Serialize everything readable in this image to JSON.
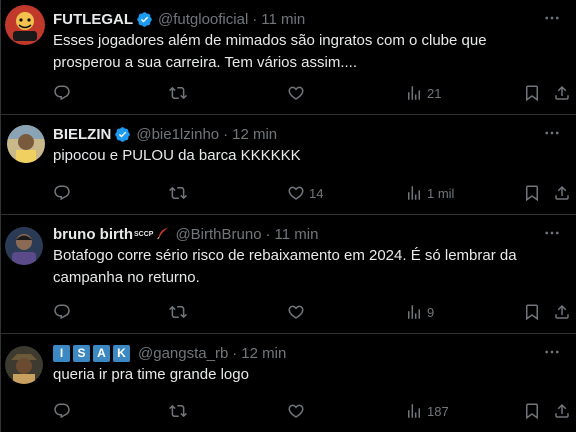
{
  "colors": {
    "background": "#000000",
    "text_primary": "#e7e9ea",
    "text_secondary": "#71767b",
    "verified_blue": "#1d9bf0",
    "divider": "#2f3336"
  },
  "tweets": [
    {
      "display_name": "FUTLEGAL",
      "verified": true,
      "handle": "@futglooficial",
      "separator": "·",
      "time": "11 min",
      "text": "Esses jogadores além de mimados são ingratos com o clube que prosperou a sua carreira. Tem vários assim....",
      "replies": "",
      "retweets": "",
      "likes": "",
      "views": "21"
    },
    {
      "display_name": "BIELZIN",
      "verified": true,
      "handle": "@bie1lzinho",
      "separator": "·",
      "time": "12 min",
      "text": "pipocou e PULOU da barca KKKKKK",
      "replies": "",
      "retweets": "",
      "likes": "14",
      "views": "1 mil"
    },
    {
      "display_name": "bruno birth",
      "flair": "SCCP",
      "verified": false,
      "handle": "@BirthBruno",
      "separator": "·",
      "time": "11 min",
      "text": "Botafogo corre sério risco de rebaixamento em 2024. É só lembrar da campanha no returno.",
      "replies": "",
      "retweets": "",
      "likes": "",
      "views": "9"
    },
    {
      "display_name_letters": [
        "I",
        "S",
        "A",
        "K"
      ],
      "verified": false,
      "handle": "@gangsta_rb",
      "separator": "·",
      "time": "12 min",
      "text": "queria ir pra time grande logo",
      "replies": "",
      "retweets": "",
      "likes": "",
      "views": "187"
    }
  ],
  "icons": {
    "reply": "reply-icon",
    "retweet": "retweet-icon",
    "like": "heart-icon",
    "views": "views-icon",
    "bookmark": "bookmark-icon",
    "share": "share-icon",
    "more": "more-icon",
    "verified": "verified-badge-icon"
  }
}
